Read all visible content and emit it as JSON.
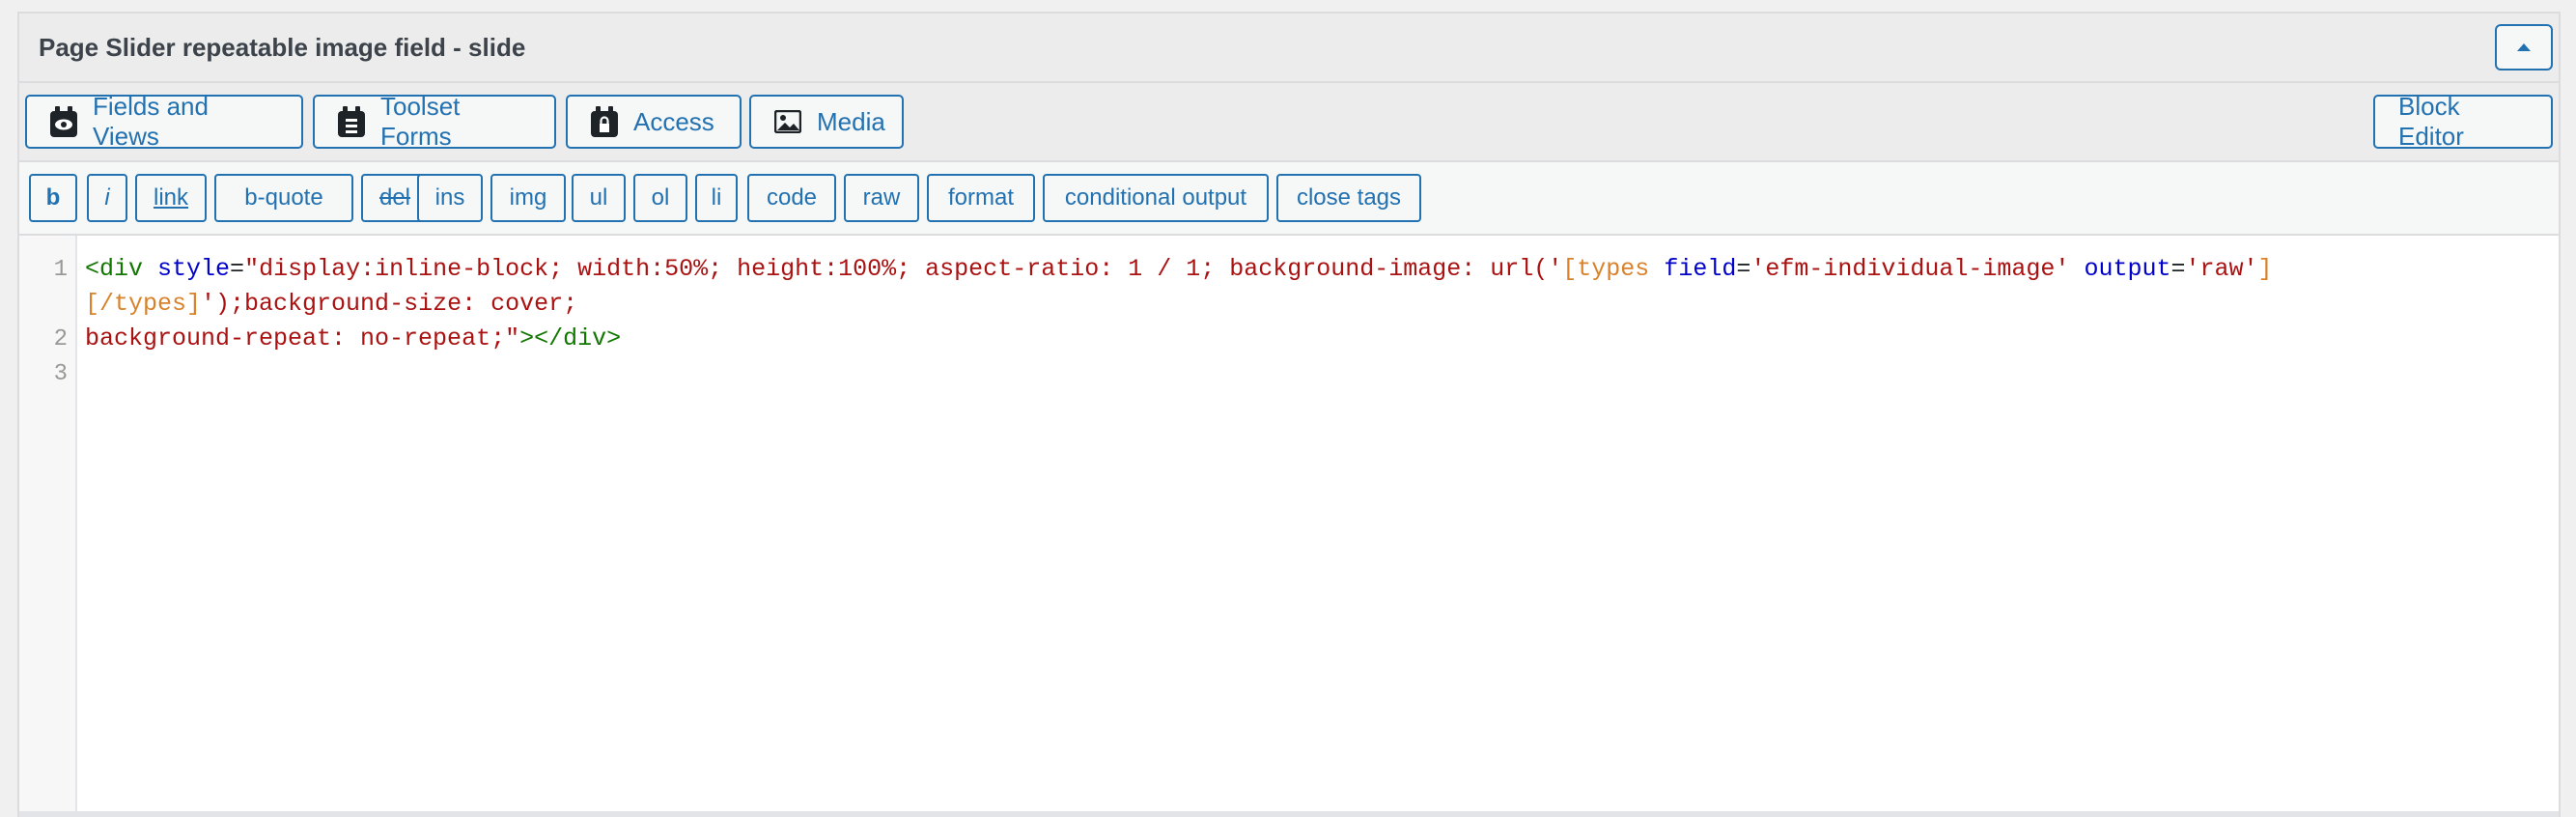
{
  "panel": {
    "title": "Page Slider repeatable image field - slide"
  },
  "toolbar": {
    "fields_and_views": "Fields and Views",
    "toolset_forms": "Toolset Forms",
    "access": "Access",
    "media": "Media",
    "block_editor": "Block Editor"
  },
  "quicktags": [
    "b",
    "i",
    "link",
    "b-quote",
    "del",
    "ins",
    "img",
    "ul",
    "ol",
    "li",
    "code",
    "raw",
    "format",
    "conditional output",
    "close tags"
  ],
  "editor": {
    "line_numbers": [
      "1",
      "2",
      "3"
    ],
    "line1": {
      "t1": "<div",
      "a1": "style",
      "p1": "=",
      "s1": "\"display:inline-block; width:50%; height:100%; aspect-ratio: 1 / 1; background-image: url('",
      "sc1": "[types",
      "a2": "field",
      "p2": "=",
      "s2": "'efm-individual-image'",
      "a3": "output",
      "p3": "=",
      "s3": "'raw'",
      "sc2": "]"
    },
    "line1_wrap": {
      "sc3": "[/types]",
      "s4": "');background-size: cover;"
    },
    "line2": {
      "s5": "background-repeat: no-repeat;\"",
      "t2": "></div>"
    }
  },
  "colors": {
    "accent": "#2271b1",
    "tag": "#117700",
    "attribute": "#0000cc",
    "string": "#aa1111",
    "shortcode": "#d9822b"
  }
}
